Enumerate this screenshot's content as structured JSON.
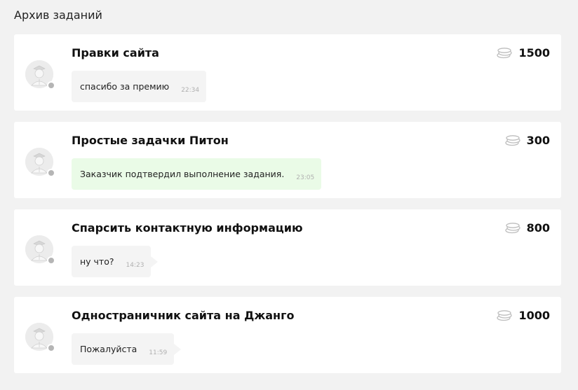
{
  "page": {
    "title": "Архив заданий"
  },
  "tasks": [
    {
      "title": "Правки сайта",
      "price": "1500",
      "message": "спасибо за премию",
      "time": "22:34",
      "message_style": "gray"
    },
    {
      "title": "Простые задачки Питон",
      "price": "300",
      "message": "Заказчик подтвердил выполнение задания.",
      "time": "23:05",
      "message_style": "green"
    },
    {
      "title": "Спарсить контактную информацию",
      "price": "800",
      "message": "ну что?",
      "time": "14:23",
      "message_style": "gray"
    },
    {
      "title": "Одностраничник сайта на Джанго",
      "price": "1000",
      "message": "Пожалуйста",
      "time": "11:59",
      "message_style": "gray"
    }
  ],
  "icons": {
    "price": "coins-icon",
    "avatar": "user-avatar-icon"
  },
  "colors": {
    "background": "#f2f2f2",
    "card": "#ffffff",
    "bubble_gray": "#f4f4f4",
    "bubble_green": "#eafbe7",
    "timestamp": "#b0b0b0"
  }
}
